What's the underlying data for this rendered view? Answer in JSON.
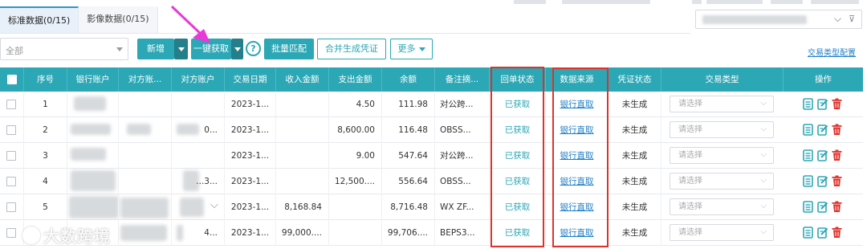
{
  "tabs": [
    {
      "label": "标准数据(0/15)",
      "active": true
    },
    {
      "label": "影像数据(0/15)",
      "active": false
    }
  ],
  "filter": {
    "value": "全部"
  },
  "toolbar": {
    "add": "新增",
    "fetch": "一键获取",
    "help": "?",
    "batch_match": "批量匹配",
    "merge_voucher": "合并生成凭证",
    "more": "更多",
    "type_config": "交易类型配置"
  },
  "table": {
    "headers": [
      "序号",
      "银行账户",
      "对方账...",
      "对方账户",
      "交易日期",
      "收入金额",
      "支出金额",
      "余额",
      "备注摘...",
      "回单状态",
      "数据来源",
      "凭证状态",
      "交易类型",
      "操作"
    ],
    "select_placeholder": "请选择",
    "rows": [
      {
        "no": "1",
        "bank": "",
        "cp_name": "",
        "cp_acct": "",
        "date": "2023-1...",
        "income": "",
        "expense": "4.50",
        "balance": "111.98",
        "memo": "对公跨...",
        "receipt": "已获取",
        "source": "银行直取",
        "voucher": "未生成"
      },
      {
        "no": "2",
        "bank": "",
        "cp_name": "",
        "cp_acct": "0...",
        "date": "2023-1...",
        "income": "",
        "expense": "8,600.00",
        "balance": "116.48",
        "memo": "OBSS...",
        "receipt": "已获取",
        "source": "银行直取",
        "voucher": "未生成"
      },
      {
        "no": "3",
        "bank": "",
        "cp_name": "",
        "cp_acct": "",
        "date": "2023-1...",
        "income": "",
        "expense": "9.00",
        "balance": "547.64",
        "memo": "对公跨...",
        "receipt": "已获取",
        "source": "银行直取",
        "voucher": "未生成"
      },
      {
        "no": "4",
        "bank": "",
        "cp_name": "",
        "cp_acct": "...3...",
        "date": "2023-1...",
        "income": "",
        "expense": "12,500....",
        "balance": "556.64",
        "memo": "OBSS...",
        "receipt": "已获取",
        "source": "银行直取",
        "voucher": "未生成"
      },
      {
        "no": "5",
        "bank": "",
        "cp_name": "",
        "cp_acct": "",
        "date": "2023-1...",
        "income": "8,168.84",
        "expense": "",
        "balance": "8,716.48",
        "memo": "WX ZF...",
        "receipt": "已获取",
        "source": "银行直取",
        "voucher": "未生成"
      },
      {
        "no": "",
        "bank": "",
        "cp_name": "",
        "cp_acct": "4...",
        "date": "2023-1...",
        "income": "99,000....",
        "expense": "",
        "balance": "99,706....",
        "memo": "BEPS3...",
        "receipt": "已获取",
        "source": "银行直取",
        "voucher": "未生成"
      }
    ]
  },
  "watermark": "大数跨境",
  "colors": {
    "accent": "#2ba7b5",
    "link": "#1f7fc8",
    "highlight": "#e0322c",
    "arrow": "#e83ad7",
    "delete": "#e0322c"
  }
}
